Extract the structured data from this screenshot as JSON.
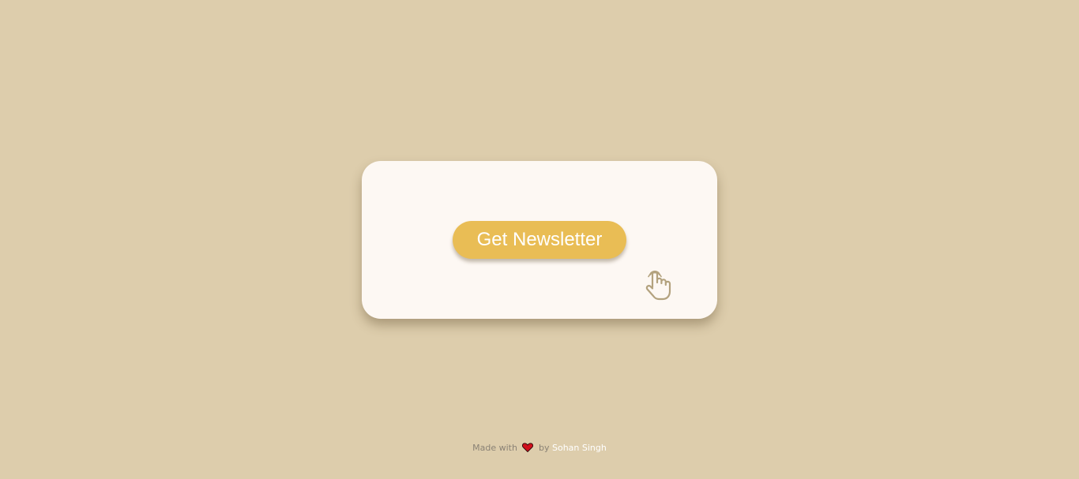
{
  "page": {
    "background_color": "#ddcdac"
  },
  "card": {
    "background_color": "#fdf8f3",
    "button": {
      "label": "Get Newsletter",
      "color": "#e9bd55",
      "text_color": "#ffffff"
    },
    "pointer_icon": "hand-pointer-icon"
  },
  "footer": {
    "prefix": "Made with",
    "heart_icon": "heart-icon",
    "heart_color": "#d0101c",
    "by": "by",
    "author": "Sohan Singh"
  }
}
